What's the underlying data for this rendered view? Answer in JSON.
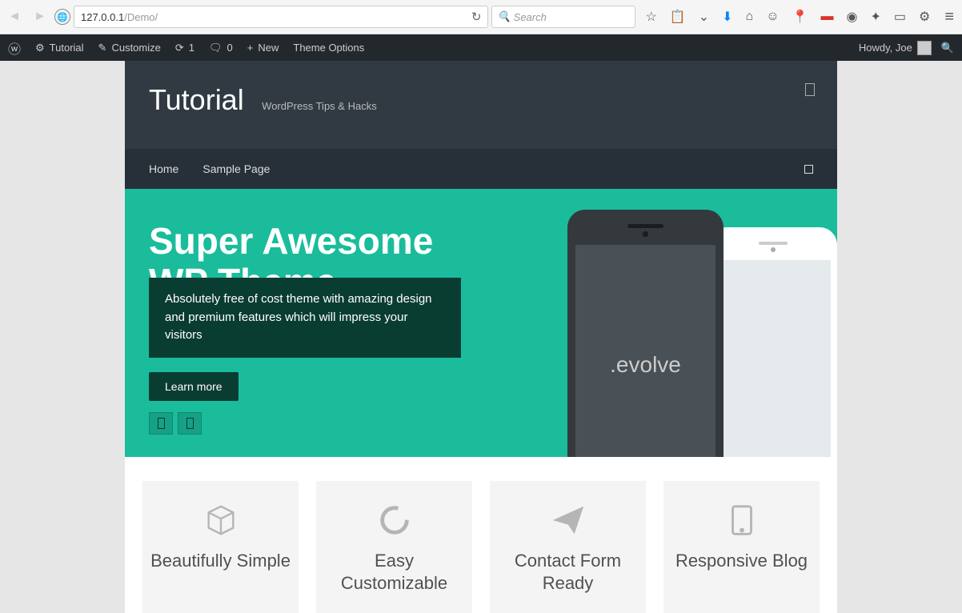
{
  "browser": {
    "url_host": "127.0.0.1",
    "url_path": "/Demo/",
    "search_placeholder": "Search"
  },
  "wp_admin": {
    "site_name": "Tutorial",
    "customize": "Customize",
    "updates": "1",
    "comments": "0",
    "new": "New",
    "theme_options": "Theme Options",
    "howdy": "Howdy, Joe"
  },
  "header": {
    "title": "Tutorial",
    "tagline": "WordPress Tips & Hacks"
  },
  "nav": {
    "items": [
      "Home",
      "Sample Page"
    ]
  },
  "hero": {
    "title": "Super Awesome WP Theme",
    "description": "Absolutely free of cost theme with amazing design and premium features which will impress your visitors",
    "button": "Learn more",
    "phone_text": ".evolve"
  },
  "features": [
    {
      "title": "Beautifully Simple"
    },
    {
      "title": "Easy Customizable"
    },
    {
      "title": "Contact Form Ready"
    },
    {
      "title": "Responsive Blog"
    }
  ]
}
